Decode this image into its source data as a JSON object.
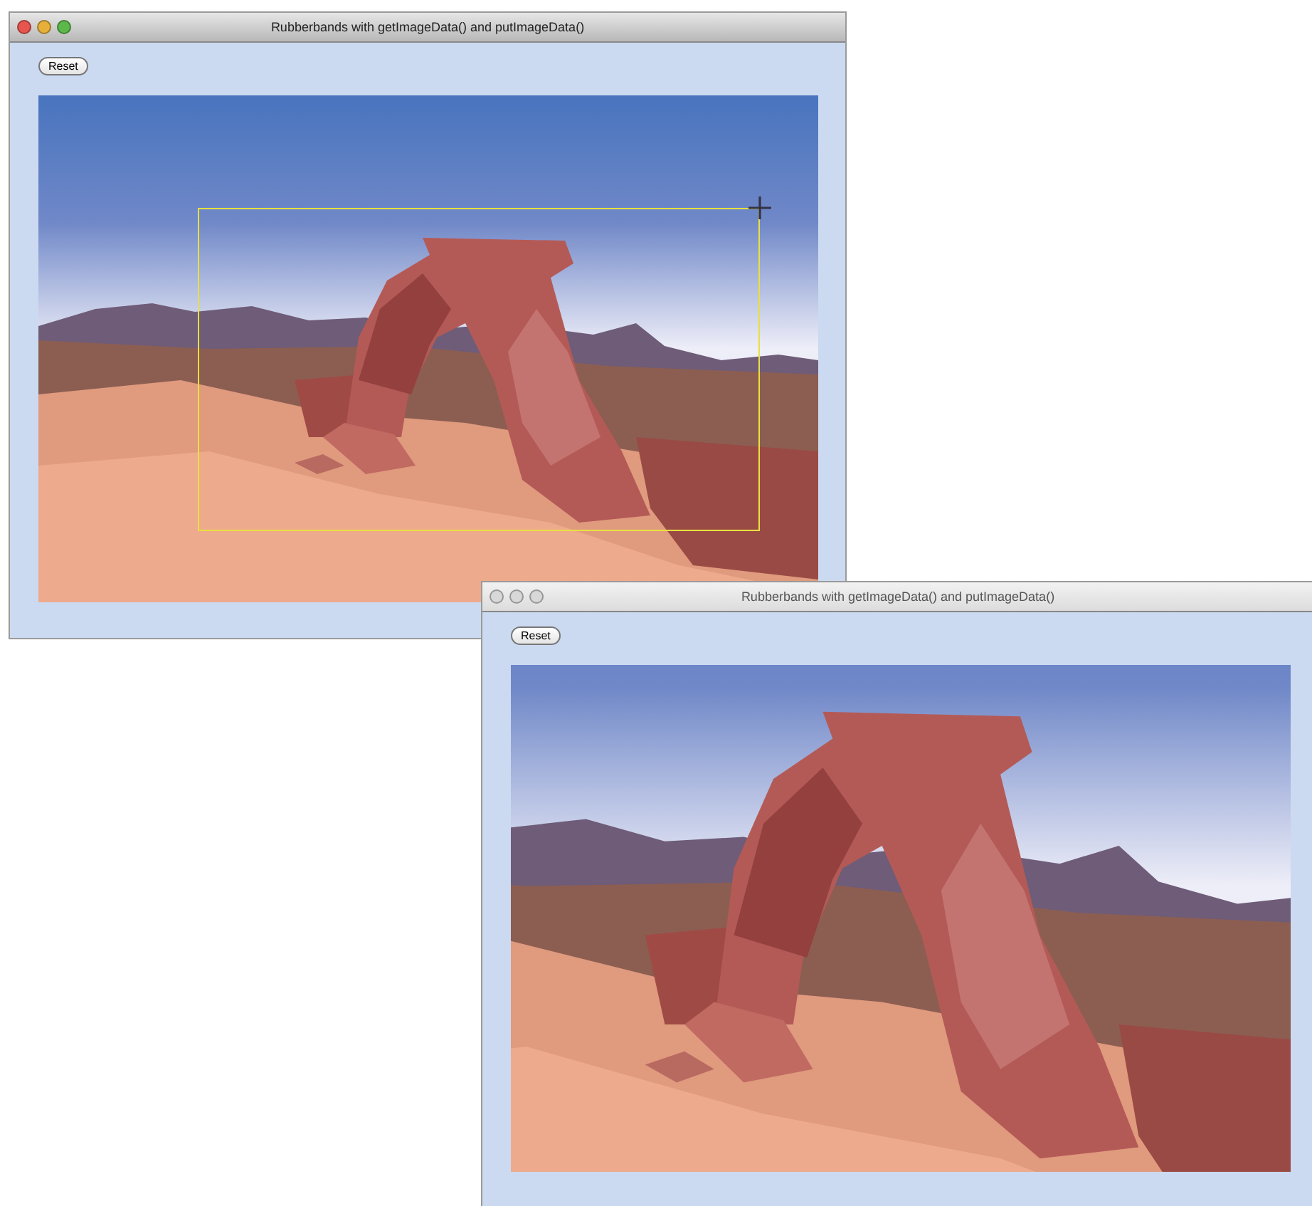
{
  "windows": [
    {
      "title": "Rubberbands with getImageData() and putImageData()",
      "active": true,
      "reset_button": "Reset",
      "canvas": {
        "kind": "picture",
        "zoomed": false,
        "rubberband_visible": true
      }
    },
    {
      "title": "Rubberbands with getImageData() and putImageData()",
      "active": false,
      "reset_button": "Reset",
      "canvas": {
        "kind": "picture",
        "zoomed": true,
        "rubberband_visible": false
      }
    }
  ]
}
